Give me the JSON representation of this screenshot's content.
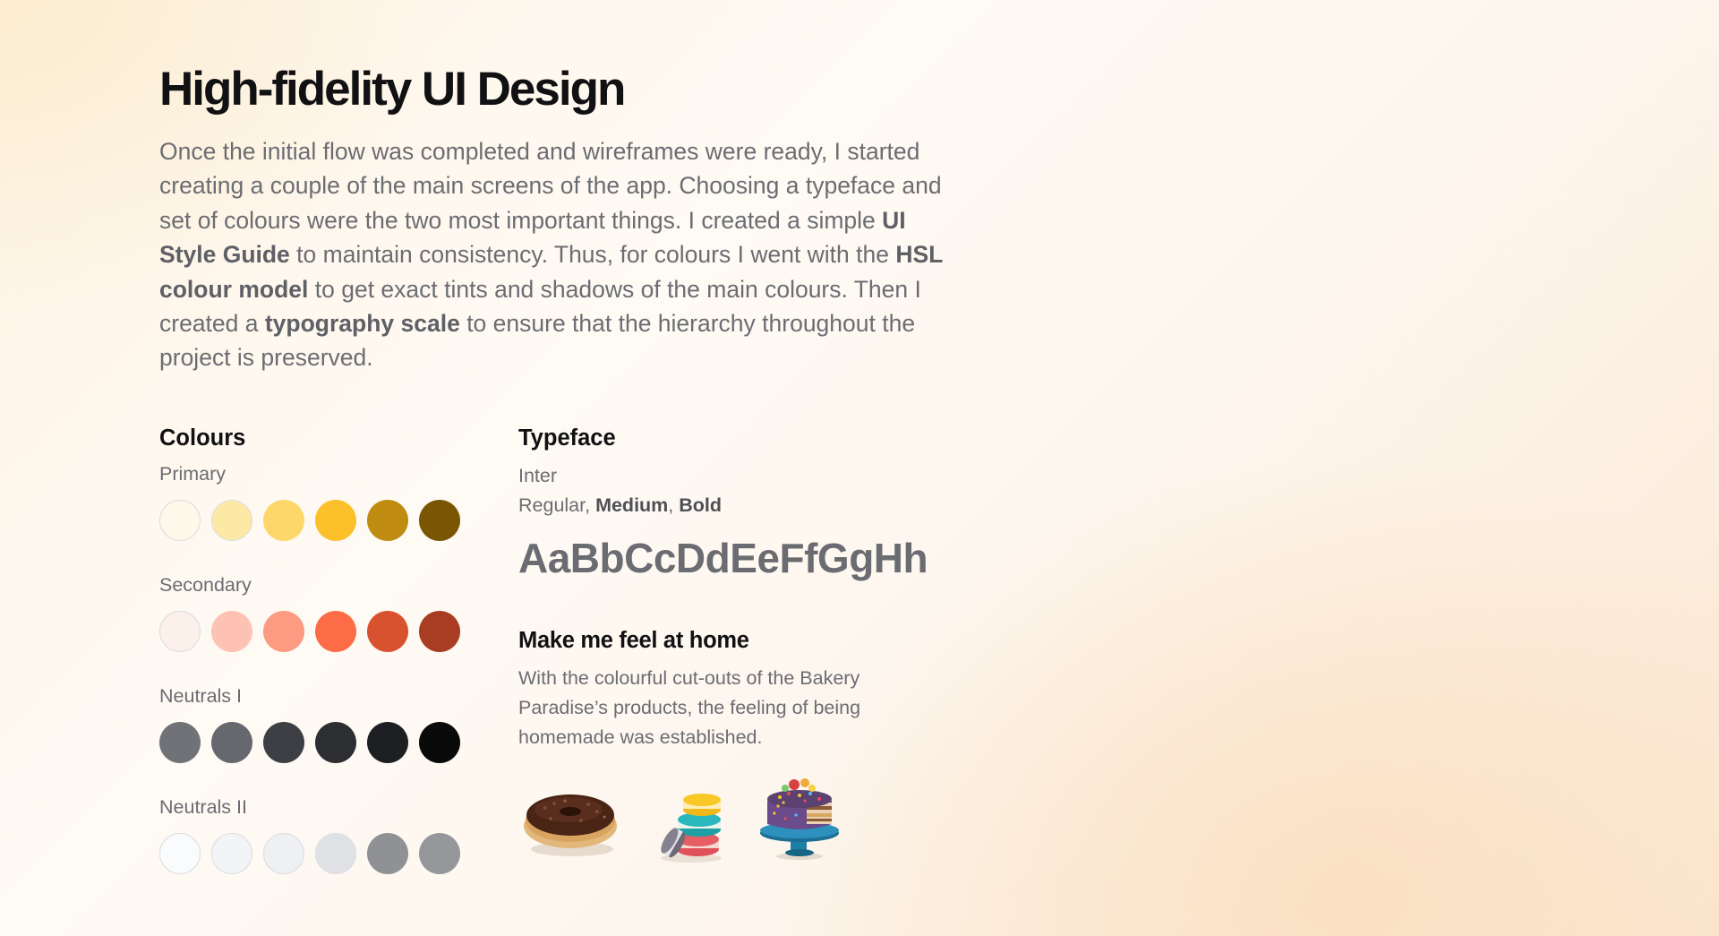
{
  "header": {
    "title": "High-fidelity UI Design"
  },
  "intro": {
    "part1": "Once the initial flow was completed and wireframes were ready, I started creating a couple of the main screens of the app. Choosing a typeface and set of colours were the two most important things. I created a simple ",
    "bold1": "UI Style Guide",
    "part2": " to maintain consistency. Thus, for colours I went with the ",
    "bold2": "HSL colour model",
    "part3": " to get exact tints and shadows of the main colours. Then I created a ",
    "bold3": "typography scale",
    "part4": " to ensure that the hierarchy throughout the project is preserved."
  },
  "colours": {
    "title": "Colours",
    "groups": [
      {
        "label": "Primary",
        "swatches": [
          "#fdf8e9",
          "#fde9a6",
          "#fed76a",
          "#fbc02a",
          "#bf8b10",
          "#7a5604"
        ]
      },
      {
        "label": "Secondary",
        "swatches": [
          "#fcf0ea",
          "#fdc2b3",
          "#fd9a82",
          "#fd6c46",
          "#d9522f",
          "#a93d22"
        ]
      },
      {
        "label": "Neutrals I",
        "swatches": [
          "#707277",
          "#66686d",
          "#3d3f44",
          "#2c2e32",
          "#1d1f22",
          "#0a0a0b"
        ]
      },
      {
        "label": "Neutrals II",
        "swatches": [
          "#fafbfd",
          "#f3f4f7",
          "#eef0f3",
          "#e0e1e4",
          "#8f9195",
          "#95979b"
        ]
      }
    ]
  },
  "typeface": {
    "title": "Typeface",
    "name": "Inter",
    "weights": {
      "regular": "Regular, ",
      "medium": "Medium",
      "separator": ", ",
      "bold": "Bold"
    },
    "sample": "AaBbCcDdEeFfGgHh"
  },
  "home": {
    "title": "Make me feel at home",
    "text": "With the colourful cut-outs of the Bakery Paradise’s products, the feeling of being homemade was established.",
    "products": [
      "donut",
      "macarons",
      "cake"
    ]
  }
}
